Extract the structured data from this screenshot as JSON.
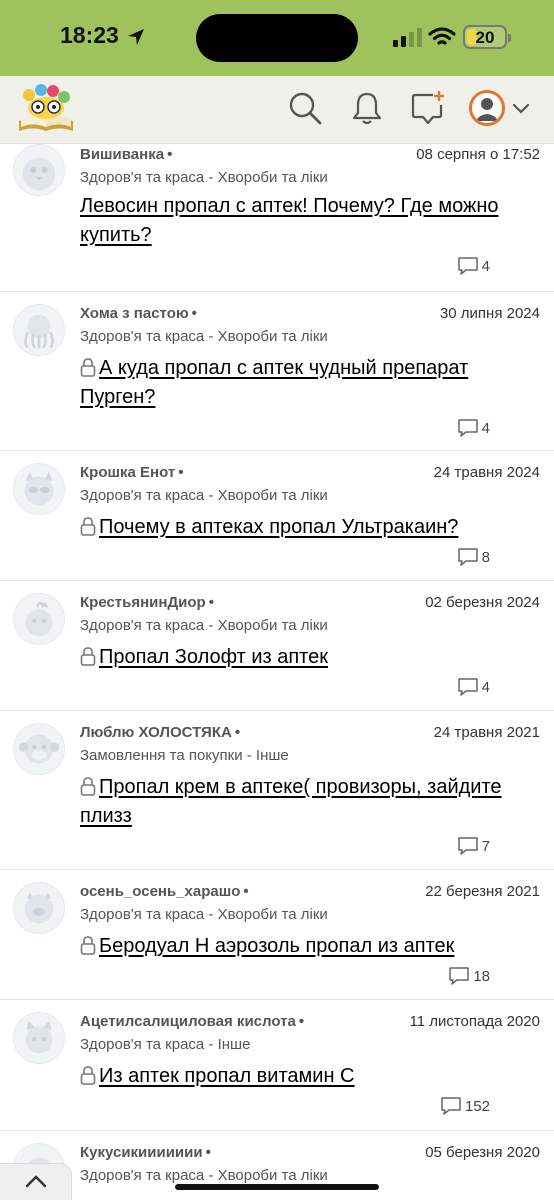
{
  "status_bar": {
    "time": "18:23",
    "battery": "20"
  },
  "app_bar": {
    "icons": [
      "logo-icon",
      "search-icon",
      "bell-icon",
      "new-message-icon",
      "user-avatar-icon",
      "chevron-down-icon"
    ],
    "colors": {
      "bar": "#f0f0ea",
      "status": "#9fc35c",
      "avatar_ring": "#e8732a",
      "plus": "#e8732a"
    }
  },
  "posts": [
    {
      "author": "Вишиванка",
      "date": "08 серпня о 17:52",
      "category": "Здоров'я та краса - Хвороби та ліки",
      "title": "Левосин пропал с аптек! Почему? Где можно купить?",
      "locked": false,
      "comments": "4"
    },
    {
      "author": "Хома з пастою",
      "date": "30 липня 2024",
      "category": "Здоров'я та краса - Хвороби та ліки",
      "title": "А куда пропал с аптек чудный препарат Пурген?",
      "locked": true,
      "comments": "4"
    },
    {
      "author": "Крошка Енот",
      "date": "24 травня 2024",
      "category": "Здоров'я та краса - Хвороби та ліки",
      "title": "Почему в аптеках пропал Ультракаин?",
      "locked": true,
      "comments": "8"
    },
    {
      "author": "КрестьянинДиор",
      "date": "02 березня 2024",
      "category": "Здоров'я та краса - Хвороби та ліки",
      "title": "Пропал Золофт из аптек",
      "locked": true,
      "comments": "4"
    },
    {
      "author": "Люблю ХОЛОСТЯКА",
      "date": "24 травня 2021",
      "category": "Замовлення та покупки - Інше",
      "title": "Пропал крем в аптеке( провизоры, зайдите плизз",
      "locked": true,
      "comments": "7"
    },
    {
      "author": "осень_осень_харашо",
      "date": "22 березня 2021",
      "category": "Здоров'я та краса - Хвороби та ліки",
      "title": "Беродуал Н аэрозоль пропал из аптек",
      "locked": true,
      "comments": "18"
    },
    {
      "author": "Ацетилсалициловая кислота",
      "date": "11 листопада 2020",
      "category": "Здоров'я та краса - Інше",
      "title": "Из аптек пропал витамин С",
      "locked": true,
      "comments": "152"
    },
    {
      "author": "Кукусикиииииии",
      "date": "05 березня 2020",
      "category": "Здоров'я та краса - Хвороби та ліки",
      "title": "",
      "locked": false,
      "comments": ""
    }
  ],
  "separator": "•"
}
